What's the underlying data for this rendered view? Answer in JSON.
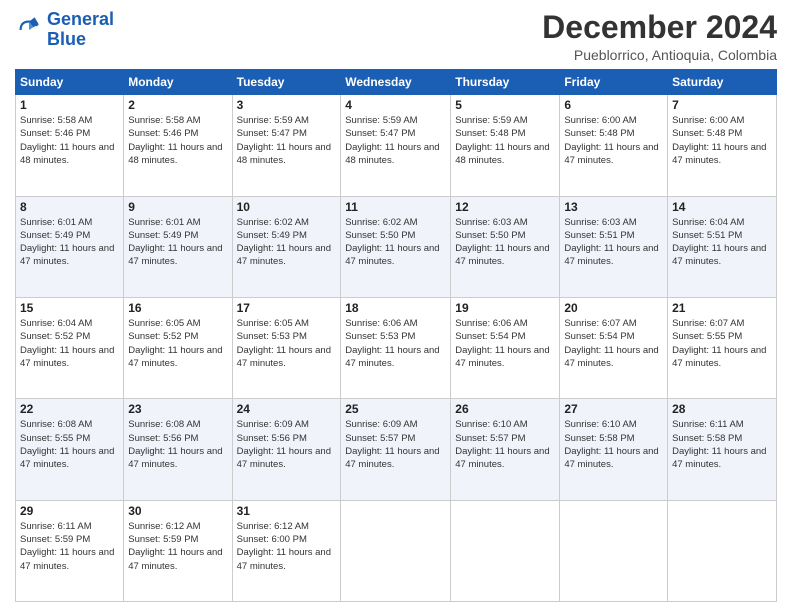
{
  "logo": {
    "line1": "General",
    "line2": "Blue"
  },
  "title": "December 2024",
  "subtitle": "Pueblorrico, Antioquia, Colombia",
  "header_days": [
    "Sunday",
    "Monday",
    "Tuesday",
    "Wednesday",
    "Thursday",
    "Friday",
    "Saturday"
  ],
  "weeks": [
    [
      {
        "day": "1",
        "sunrise": "5:58 AM",
        "sunset": "5:46 PM",
        "daylight": "11 hours and 48 minutes."
      },
      {
        "day": "2",
        "sunrise": "5:58 AM",
        "sunset": "5:46 PM",
        "daylight": "11 hours and 48 minutes."
      },
      {
        "day": "3",
        "sunrise": "5:59 AM",
        "sunset": "5:47 PM",
        "daylight": "11 hours and 48 minutes."
      },
      {
        "day": "4",
        "sunrise": "5:59 AM",
        "sunset": "5:47 PM",
        "daylight": "11 hours and 48 minutes."
      },
      {
        "day": "5",
        "sunrise": "5:59 AM",
        "sunset": "5:48 PM",
        "daylight": "11 hours and 48 minutes."
      },
      {
        "day": "6",
        "sunrise": "6:00 AM",
        "sunset": "5:48 PM",
        "daylight": "11 hours and 47 minutes."
      },
      {
        "day": "7",
        "sunrise": "6:00 AM",
        "sunset": "5:48 PM",
        "daylight": "11 hours and 47 minutes."
      }
    ],
    [
      {
        "day": "8",
        "sunrise": "6:01 AM",
        "sunset": "5:49 PM",
        "daylight": "11 hours and 47 minutes."
      },
      {
        "day": "9",
        "sunrise": "6:01 AM",
        "sunset": "5:49 PM",
        "daylight": "11 hours and 47 minutes."
      },
      {
        "day": "10",
        "sunrise": "6:02 AM",
        "sunset": "5:49 PM",
        "daylight": "11 hours and 47 minutes."
      },
      {
        "day": "11",
        "sunrise": "6:02 AM",
        "sunset": "5:50 PM",
        "daylight": "11 hours and 47 minutes."
      },
      {
        "day": "12",
        "sunrise": "6:03 AM",
        "sunset": "5:50 PM",
        "daylight": "11 hours and 47 minutes."
      },
      {
        "day": "13",
        "sunrise": "6:03 AM",
        "sunset": "5:51 PM",
        "daylight": "11 hours and 47 minutes."
      },
      {
        "day": "14",
        "sunrise": "6:04 AM",
        "sunset": "5:51 PM",
        "daylight": "11 hours and 47 minutes."
      }
    ],
    [
      {
        "day": "15",
        "sunrise": "6:04 AM",
        "sunset": "5:52 PM",
        "daylight": "11 hours and 47 minutes."
      },
      {
        "day": "16",
        "sunrise": "6:05 AM",
        "sunset": "5:52 PM",
        "daylight": "11 hours and 47 minutes."
      },
      {
        "day": "17",
        "sunrise": "6:05 AM",
        "sunset": "5:53 PM",
        "daylight": "11 hours and 47 minutes."
      },
      {
        "day": "18",
        "sunrise": "6:06 AM",
        "sunset": "5:53 PM",
        "daylight": "11 hours and 47 minutes."
      },
      {
        "day": "19",
        "sunrise": "6:06 AM",
        "sunset": "5:54 PM",
        "daylight": "11 hours and 47 minutes."
      },
      {
        "day": "20",
        "sunrise": "6:07 AM",
        "sunset": "5:54 PM",
        "daylight": "11 hours and 47 minutes."
      },
      {
        "day": "21",
        "sunrise": "6:07 AM",
        "sunset": "5:55 PM",
        "daylight": "11 hours and 47 minutes."
      }
    ],
    [
      {
        "day": "22",
        "sunrise": "6:08 AM",
        "sunset": "5:55 PM",
        "daylight": "11 hours and 47 minutes."
      },
      {
        "day": "23",
        "sunrise": "6:08 AM",
        "sunset": "5:56 PM",
        "daylight": "11 hours and 47 minutes."
      },
      {
        "day": "24",
        "sunrise": "6:09 AM",
        "sunset": "5:56 PM",
        "daylight": "11 hours and 47 minutes."
      },
      {
        "day": "25",
        "sunrise": "6:09 AM",
        "sunset": "5:57 PM",
        "daylight": "11 hours and 47 minutes."
      },
      {
        "day": "26",
        "sunrise": "6:10 AM",
        "sunset": "5:57 PM",
        "daylight": "11 hours and 47 minutes."
      },
      {
        "day": "27",
        "sunrise": "6:10 AM",
        "sunset": "5:58 PM",
        "daylight": "11 hours and 47 minutes."
      },
      {
        "day": "28",
        "sunrise": "6:11 AM",
        "sunset": "5:58 PM",
        "daylight": "11 hours and 47 minutes."
      }
    ],
    [
      {
        "day": "29",
        "sunrise": "6:11 AM",
        "sunset": "5:59 PM",
        "daylight": "11 hours and 47 minutes."
      },
      {
        "day": "30",
        "sunrise": "6:12 AM",
        "sunset": "5:59 PM",
        "daylight": "11 hours and 47 minutes."
      },
      {
        "day": "31",
        "sunrise": "6:12 AM",
        "sunset": "6:00 PM",
        "daylight": "11 hours and 47 minutes."
      },
      null,
      null,
      null,
      null
    ]
  ]
}
